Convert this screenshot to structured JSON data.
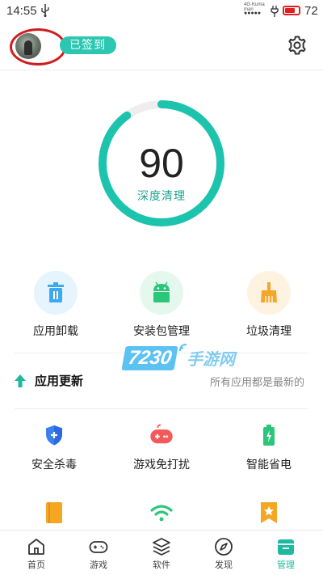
{
  "status_bar": {
    "time": "14:55",
    "signal_label": "4G·Kuma\nman",
    "signal_dots": "●●●●●",
    "battery_level": "72",
    "battery_fraction": 0.72,
    "battery_color": "#e02020"
  },
  "header": {
    "checkin_label": "已签到",
    "accent_color": "#2cc7b0"
  },
  "gauge": {
    "score": "90",
    "label": "深度清理",
    "fraction": 0.9,
    "color": "#1cc3ad",
    "track_color": "#eeeeee"
  },
  "tools": [
    {
      "label": "应用卸载",
      "icon": "trash-icon",
      "color": "#3daaf0"
    },
    {
      "label": "安装包管理",
      "icon": "android-package-icon",
      "color": "#2cc67a"
    },
    {
      "label": "垃圾清理",
      "icon": "broom-icon",
      "color": "#f3a72c"
    }
  ],
  "watermark": {
    "number": "7230",
    "text": "手游网"
  },
  "update": {
    "title": "应用更新",
    "status": "所有应用都是最新的"
  },
  "features": [
    {
      "label": "安全杀毒",
      "icon": "shield-icon",
      "color": "#3d7ff0"
    },
    {
      "label": "游戏免打扰",
      "icon": "gamepad-icon",
      "color": "#f25a5a"
    },
    {
      "label": "智能省电",
      "icon": "battery-icon",
      "color": "#2cc67a"
    }
  ],
  "partial_features": [
    {
      "icon": "book-icon",
      "color": "#f5a623"
    },
    {
      "icon": "wifi-icon",
      "color": "#2cc67a"
    },
    {
      "icon": "bookmark-icon",
      "color": "#f5a623"
    }
  ],
  "nav": {
    "items": [
      {
        "label": "首页",
        "icon": "home-icon"
      },
      {
        "label": "游戏",
        "icon": "gamepad-icon"
      },
      {
        "label": "软件",
        "icon": "layers-icon"
      },
      {
        "label": "发现",
        "icon": "compass-icon"
      },
      {
        "label": "管理",
        "icon": "manage-icon"
      }
    ],
    "active_index": 4,
    "active_color": "#1fb9a0"
  }
}
